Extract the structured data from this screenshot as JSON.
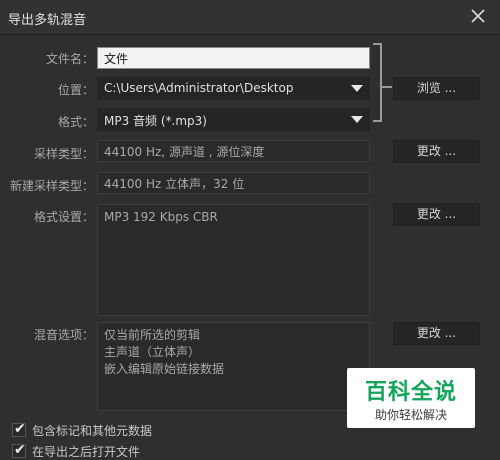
{
  "window": {
    "title": "导出多轨混音"
  },
  "form": {
    "filename": {
      "label": "文件名：",
      "value": "文件"
    },
    "location": {
      "label": "位置：",
      "value": "C:\\Users\\Administrator\\Desktop",
      "browse_label": "浏览 ..."
    },
    "format": {
      "label": "格式：",
      "value": "MP3 音频 (*.mp3)"
    },
    "sample_type": {
      "label": "采样类型：",
      "value": "44100 Hz, 源声道 , 源位深度",
      "change_label": "更改 ..."
    },
    "new_sample_type": {
      "label": "新建采样类型：",
      "value": "44100 Hz 立体声，32 位"
    },
    "format_settings": {
      "label": "格式设置：",
      "value": "MP3 192 Kbps CBR",
      "change_label": "更改 ..."
    },
    "mix_options": {
      "label": "混音选项：",
      "lines": [
        "仅当前所选的剪辑",
        "主声道（立体声）",
        "嵌入编辑原始链接数据"
      ],
      "change_label": "更改 ..."
    }
  },
  "checkboxes": [
    {
      "label": "包含标记和其他元数据",
      "checked": true
    },
    {
      "label": "在导出之后打开文件",
      "checked": true
    }
  ],
  "watermark": {
    "title": "百科全说",
    "subtitle": "助你轻松解决"
  },
  "colors": {
    "background": "#2f2f2f",
    "watermark_green": "#14a45a"
  }
}
